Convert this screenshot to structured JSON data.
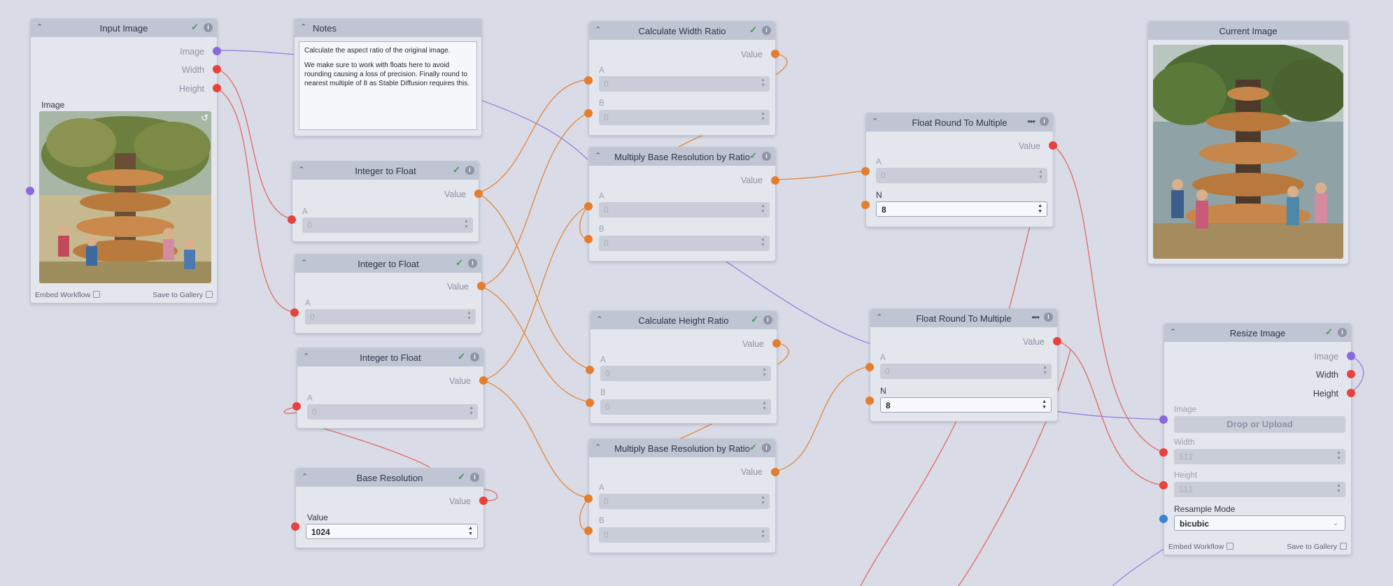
{
  "nodes": {
    "input_image": {
      "title": "Input Image",
      "out_image": "Image",
      "out_width": "Width",
      "out_height": "Height",
      "field_label": "Image",
      "embed": "Embed Workflow",
      "save": "Save to Gallery"
    },
    "notes": {
      "title": "Notes",
      "line1": "Calculate the aspect ratio of the original image.",
      "line2": "We make sure to work with floats here to avoid rounding causing a loss of precision. Finally round to nearest multiple of 8 as Stable Diffusion requires this."
    },
    "int_float_1": {
      "title": "Integer to Float",
      "out": "Value",
      "label_a": "A",
      "a": "0"
    },
    "int_float_2": {
      "title": "Integer to Float",
      "out": "Value",
      "label_a": "A",
      "a": "0"
    },
    "int_float_3": {
      "title": "Integer to Float",
      "out": "Value",
      "label_a": "A",
      "a": "0"
    },
    "base_resolution": {
      "title": "Base Resolution",
      "out": "Value",
      "label": "Value",
      "value": "1024"
    },
    "calc_width": {
      "title": "Calculate Width Ratio",
      "out": "Value",
      "label_a": "A",
      "a": "0",
      "label_b": "B",
      "b": "0"
    },
    "mult_base_1": {
      "title": "Multiply Base Resolution by Ratio",
      "out": "Value",
      "label_a": "A",
      "a": "0",
      "label_b": "B",
      "b": "0"
    },
    "calc_height": {
      "title": "Calculate Height Ratio",
      "out": "Value",
      "label_a": "A",
      "a": "0",
      "label_b": "B",
      "b": "0"
    },
    "mult_base_2": {
      "title": "Multiply Base Resolution by Ratio",
      "out": "Value",
      "label_a": "A",
      "a": "0",
      "label_b": "B",
      "b": "0"
    },
    "float_round_1": {
      "title": "Float Round To Multiple",
      "out": "Value",
      "label_a": "A",
      "a": "0",
      "label_n": "N",
      "n": "8"
    },
    "float_round_2": {
      "title": "Float Round To Multiple",
      "out": "Value",
      "label_a": "A",
      "a": "0",
      "label_n": "N",
      "n": "8"
    },
    "current_image": {
      "title": "Current Image"
    },
    "resize_image": {
      "title": "Resize Image",
      "out_image": "Image",
      "out_width": "Width",
      "out_height": "Height",
      "label_image": "Image",
      "drop": "Drop or Upload",
      "label_width": "Width",
      "width": "512",
      "label_height": "Height",
      "height": "512",
      "label_mode": "Resample Mode",
      "mode": "bicubic",
      "embed": "Embed Workflow",
      "save": "Save to Gallery"
    }
  },
  "colors": {
    "background": "#d9dce6",
    "node_header": "#bfc5d2",
    "image_wire": "#9a86e0",
    "int_wire": "#e0706a",
    "float_wire": "#e38a45"
  },
  "icons": [
    "chevron-up-icon",
    "check-icon",
    "info-icon",
    "more-dots-icon",
    "reset-icon",
    "chevron-down-icon"
  ]
}
